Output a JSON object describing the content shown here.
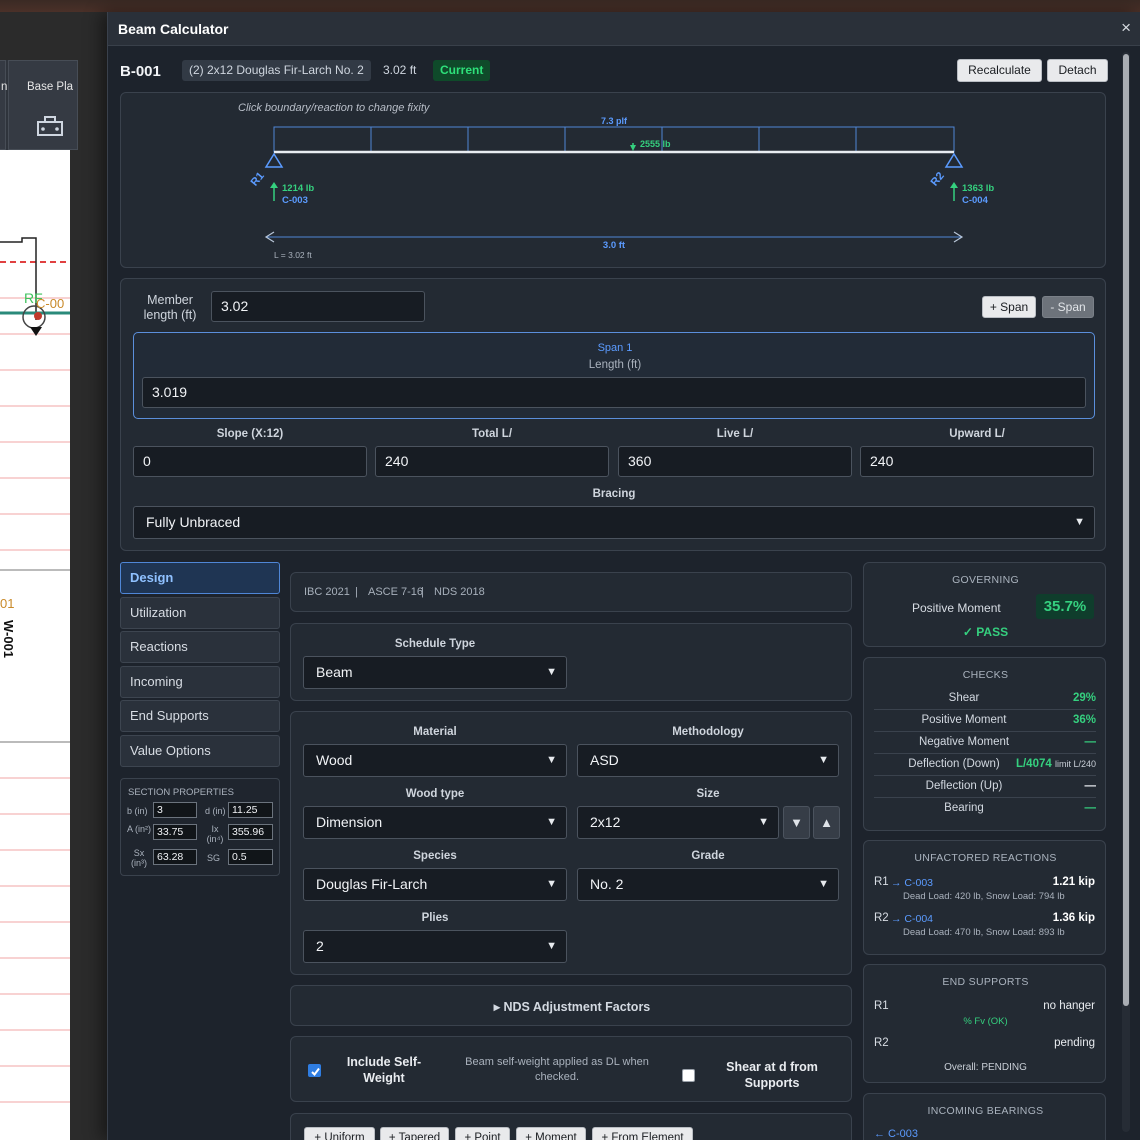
{
  "background": {
    "toolbar_left_label": "n",
    "toolbar_label": "Base Pla",
    "canvas_label_rf": "RF",
    "canvas_label_c00": "C-00",
    "canvas_label_01": "01",
    "canvas_label_w001": "W-001"
  },
  "modal": {
    "title": "Beam Calculator",
    "close_glyph": "×"
  },
  "header": {
    "beam_id": "B-001",
    "description": "(2) 2x12 Douglas Fir-Larch No. 2",
    "length": "3.02 ft",
    "status": "Current",
    "recalculate_label": "Recalculate",
    "detach_label": "Detach"
  },
  "diagram": {
    "hint": "Click boundary/reaction to change fixity",
    "uniform_load": "7.3 plf",
    "point_load": "2555 lb",
    "r1_label": "R1",
    "r2_label": "R2",
    "r1_reaction": "1214 lb",
    "r1_link": "C-003",
    "r2_reaction": "1363 lb",
    "r2_link": "C-004",
    "span_dim": "3.0 ft",
    "length_note": "L = 3.02 ft"
  },
  "spans": {
    "member_length_label": "Member length (ft)",
    "member_length_value": "3.02",
    "add_span_label": "+ Span",
    "remove_span_label": "- Span",
    "span_title": "Span 1",
    "length_label": "Length (ft)",
    "length_value": "3.019",
    "slope_label": "Slope (X:12)",
    "slope_value": "0",
    "total_label": "Total L/",
    "total_value": "240",
    "live_label": "Live L/",
    "live_value": "360",
    "upward_label": "Upward L/",
    "upward_value": "240",
    "bracing_label": "Bracing",
    "bracing_value": "Fully Unbraced"
  },
  "tabs": [
    "Design",
    "Utilization",
    "Reactions",
    "Incoming",
    "End Supports",
    "Value Options"
  ],
  "section_properties": {
    "title": "SECTION PROPERTIES",
    "b_label": "b (in)",
    "b_value": "3",
    "d_label": "d (in)",
    "d_value": "11.25",
    "a_label": "A (in²)",
    "a_value": "33.75",
    "ix_label": "Ix (in⁴)",
    "ix_value": "355.96",
    "sx_label": "Sx (in³)",
    "sx_value": "63.28",
    "sg_label": "SG",
    "sg_value": "0.5"
  },
  "design": {
    "codes": [
      "IBC 2021",
      "ASCE 7-16",
      "NDS 2018"
    ],
    "code_sep": "|",
    "schedule_type_label": "Schedule Type",
    "schedule_type_value": "Beam",
    "material_label": "Material",
    "material_value": "Wood",
    "methodology_label": "Methodology",
    "methodology_value": "ASD",
    "wood_type_label": "Wood type",
    "wood_type_value": "Dimension",
    "size_label": "Size",
    "size_value": "2x12",
    "species_label": "Species",
    "species_value": "Douglas Fir-Larch",
    "grade_label": "Grade",
    "grade_value": "No. 2",
    "plies_label": "Plies",
    "plies_value": "2",
    "nds_label": "▸ NDS Adjustment Factors",
    "self_weight_label": "Include Self-Weight",
    "self_weight_note": "Beam self-weight applied as DL when checked.",
    "shear_at_d_label": "Shear at d from Supports",
    "self_weight_checked": true,
    "shear_at_d_checked": false
  },
  "load_buttons": [
    "+ Uniform",
    "+ Tapered",
    "+ Point",
    "+ Moment",
    "+ From Element"
  ],
  "governing": {
    "title": "GOVERNING",
    "name": "Positive Moment",
    "ratio": "35.7%",
    "status": "✓ PASS"
  },
  "checks": {
    "title": "CHECKS",
    "rows": [
      {
        "name": "Shear",
        "value": "29%"
      },
      {
        "name": "Positive Moment",
        "value": "36%"
      },
      {
        "name": "Negative Moment",
        "value": "—"
      },
      {
        "name": "Deflection (Down)",
        "value": "L/4074",
        "extra": "limit L/240"
      },
      {
        "name": "Deflection (Up)",
        "value": "—"
      },
      {
        "name": "Bearing",
        "value": "—"
      }
    ]
  },
  "reactions": {
    "title": "UNFACTORED REACTIONS",
    "r1": {
      "label": "R1",
      "link": "→ C-003",
      "value": "1.21 kip",
      "detail": "Dead Load: 420 lb, Snow Load: 794 lb"
    },
    "r2": {
      "label": "R2",
      "link": "→ C-004",
      "value": "1.36 kip",
      "detail": "Dead Load: 470 lb, Snow Load: 893 lb"
    }
  },
  "end_supports": {
    "title": "END SUPPORTS",
    "r1_label": "R1",
    "r1_value": "no hanger",
    "r1_note": "% Fv (OK)",
    "r2_label": "R2",
    "r2_value": "pending",
    "overall": "Overall: PENDING"
  },
  "incoming": {
    "title": "INCOMING BEARINGS",
    "first": "← C-003"
  },
  "colors": {
    "accent_blue": "#5b9bff",
    "pass_green": "#35d07f",
    "panel": "#232a33"
  }
}
